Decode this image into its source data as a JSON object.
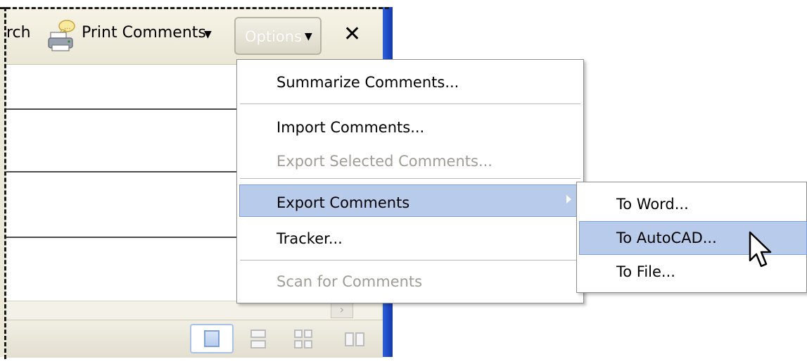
{
  "toolbar": {
    "search_partial": "rch",
    "print_comments_label": "Print Comments",
    "print_comments_arrow": "▼",
    "options_label": "Options",
    "options_arrow": "▼",
    "close_label": "✕"
  },
  "options_menu": {
    "summarize_label": "Summarize Comments...",
    "import_label": "Import Comments...",
    "export_selected_label": "Export Selected Comments...",
    "export_comments_label": "Export Comments",
    "tracker_label": "Tracker...",
    "scan_label": "Scan for Comments"
  },
  "export_submenu": {
    "to_word_label": "To Word...",
    "to_autocad_label": "To AutoCAD...",
    "to_file_label": "To File..."
  },
  "scrollbar": {
    "right_arrow": "›"
  },
  "colors": {
    "menu_highlight": "#b8cbeb",
    "menu_highlight_border": "#7f9fd5",
    "window_blue": "#1d47c4"
  },
  "icons": [
    "printer-comment-icon",
    "close-icon",
    "submenu-arrow-icon",
    "mouse-cursor-icon",
    "single-page-view-icon",
    "continuous-view-icon",
    "facing-view-icon",
    "continuous-facing-view-icon"
  ]
}
